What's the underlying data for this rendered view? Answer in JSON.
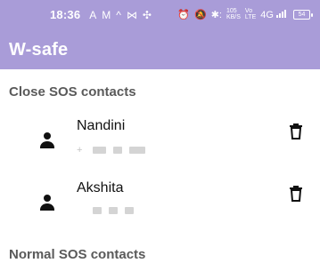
{
  "status_bar": {
    "time": "18:36",
    "left_icons": [
      "A",
      "M",
      "^",
      "⋈",
      "✣"
    ],
    "right_icons": [
      "⏰",
      "🔕",
      "✱:"
    ],
    "speed_value": "105",
    "speed_unit": "KB/S",
    "network_label": "Vo",
    "network_sub": "LTE",
    "signal_text": "4G",
    "battery_text": "54"
  },
  "app_bar": {
    "title": "W-safe"
  },
  "sections": {
    "close_title": "Close SOS contacts",
    "normal_title": "Normal SOS contacts"
  },
  "contacts": [
    {
      "name": "Nandini",
      "phone_prefix": "+",
      "icon": "person-icon",
      "action_icon": "delete-icon"
    },
    {
      "name": "Akshita",
      "phone_prefix": "",
      "icon": "person-icon",
      "action_icon": "delete-icon"
    }
  ],
  "colors": {
    "accent": "#a99cd8",
    "text_primary": "#111111",
    "section_text": "#5a5a5a",
    "masked_text": "#cfcfcf"
  }
}
